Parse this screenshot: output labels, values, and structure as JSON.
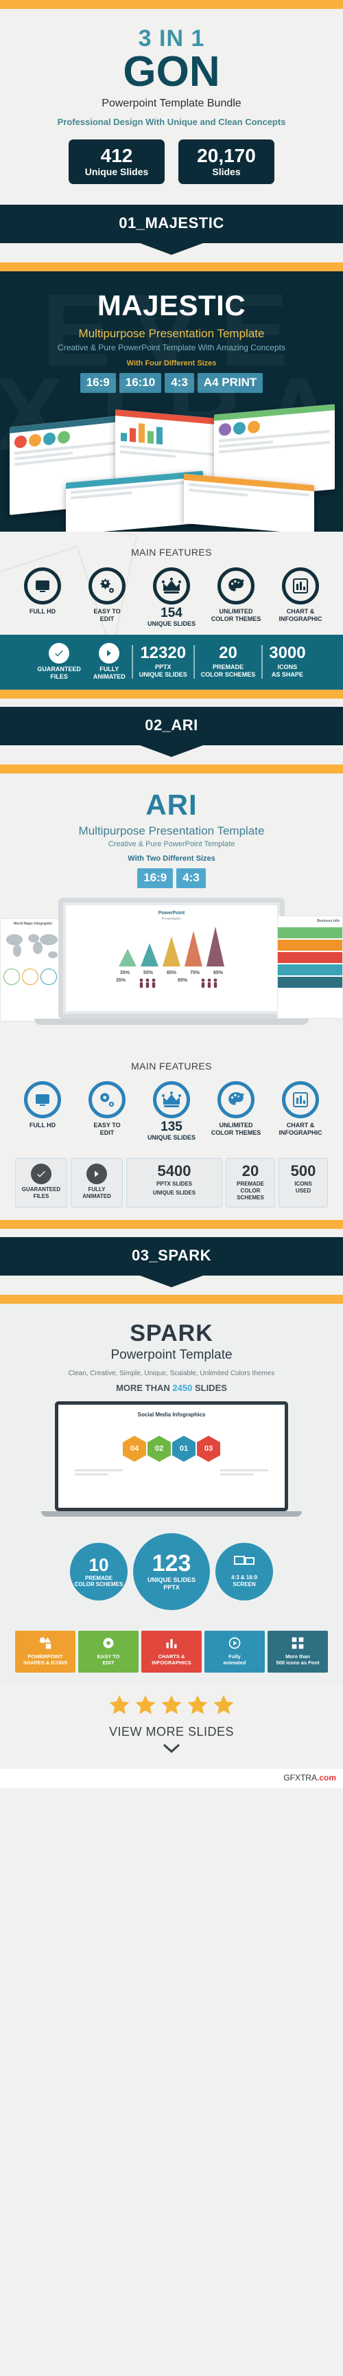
{
  "colors": {
    "amber": "#fbb03b",
    "dark_navy": "#0c2b38",
    "teal": "#12697c",
    "accent_blue": "#2e92b5",
    "light_bg": "#f1f1f0"
  },
  "hero": {
    "three_in_one": "3 IN 1",
    "brand": "GON",
    "subtitle": "Powerpoint Template Bundle",
    "tagline": "Professional Design With Unique and Clean Concepts",
    "stats": [
      {
        "number": "412",
        "label": "Unique Slides"
      },
      {
        "number": "20,170",
        "label": "Slides"
      }
    ]
  },
  "sections": [
    {
      "banner": "01_MAJESTIC",
      "title": "MAJESTIC",
      "subtitle": "Multipurpose Presentation Template",
      "description": "Creative & Pure PowerPoint Template With Amazing Concepts",
      "sizes_label": "With Four Different Sizes",
      "sizes": [
        "16:9",
        "16:10",
        "4:3",
        "A4 PRINT"
      ],
      "features_heading": "MAIN FEATURES",
      "features": [
        {
          "icon": "monitor-icon",
          "label": "FULL HD"
        },
        {
          "icon": "gear-icon",
          "label": "EASY TO\nEDIT"
        },
        {
          "icon": "crown-icon",
          "number": "154",
          "label": "UNIQUE SLIDES"
        },
        {
          "icon": "palette-icon",
          "label": "UNLIMITED\nCOLOR THEMES"
        },
        {
          "icon": "chart-icon",
          "label": "CHART &\nINFOGRAPHIC"
        }
      ],
      "strip": [
        {
          "icon": "check-icon",
          "label": "GUARANTEED\nFILES"
        },
        {
          "icon": "play-icon",
          "label": "FULLY\nANIMATED"
        },
        {
          "number": "12320",
          "label": "PPTX\nUNIQUE SLIDES"
        },
        {
          "number": "20",
          "label": "PREMADE\nCOLOR SCHEMES"
        },
        {
          "number": "3000",
          "label": "ICONS\nAS SHAPE"
        }
      ]
    },
    {
      "banner": "02_ARI",
      "title": "ARI",
      "subtitle": "Multipurpose Presentation Template",
      "description": "Creative & Pure PowerPoint Template",
      "sizes_label": "With Two Different Sizes",
      "sizes": [
        "16:9",
        "4:3"
      ],
      "features_heading": "MAIN FEATURES",
      "features": [
        {
          "icon": "monitor-icon",
          "label": "FULL HD"
        },
        {
          "icon": "gear-icon",
          "label": "EASY TO\nEDIT"
        },
        {
          "icon": "crown-icon",
          "number": "135",
          "label": "UNIQUE SLIDES"
        },
        {
          "icon": "palette-icon",
          "label": "UNLIMITED\nCOLOR THEMES"
        },
        {
          "icon": "chart-icon",
          "label": "CHART &\nINFOGRAPHIC"
        }
      ],
      "cards": [
        {
          "icon": "badge-check-icon",
          "label": "GUARANTEED\nFILES"
        },
        {
          "icon": "play-icon",
          "label": "FULLY\nANIMATED"
        },
        {
          "number": "5400",
          "label": "UNIQUE SLIDES",
          "sup": "PPTX SLIDES"
        },
        {
          "number": "20",
          "label": "PREMADE\nCOLOR SCHEMES"
        },
        {
          "number": "500",
          "label": "ICONS\nUSED"
        }
      ],
      "slide_preview": {
        "title": "PowerPoint",
        "subtitle": "Presentation",
        "percents": [
          "35%",
          "65%"
        ],
        "bar_labels": [
          "35%",
          "55%",
          "65%",
          "75%",
          "85%"
        ],
        "left_label": "World Maps Infographic",
        "right_label": "Business Info"
      }
    },
    {
      "banner": "03_SPARK",
      "title": "SPARK",
      "subtitle": "Powerpoint Template",
      "description": "Clean, Creative, Simple, Unique, Scalable, Unlimited Colors themes",
      "more_than_prefix": "MORE THAN",
      "more_than_number": "2450",
      "more_than_suffix": "SLIDES",
      "slide_preview": {
        "title": "Social Media Infographics",
        "hexes": [
          "04",
          "02",
          "01",
          "03"
        ]
      },
      "stats": [
        {
          "number": "10",
          "label": "PREMADE\nCOLOR SCHEMES"
        },
        {
          "number": "123",
          "label": "UNIQUE SLIDES\nPPTX"
        },
        {
          "number": "",
          "label": "4:3 & 16:9\nSCREEN"
        }
      ],
      "tiles": [
        {
          "color": "#f0a02e",
          "icon": "shapes-icon",
          "label": "POWERPOINT\nSHAPES & ICONS"
        },
        {
          "color": "#6fb644",
          "icon": "gear-icon",
          "label": "EASY TO\nEDIT"
        },
        {
          "color": "#e1473d",
          "icon": "chart-icon",
          "label": "CHARTS &\nINFOGRAPHICS"
        },
        {
          "color": "#2e92b5",
          "icon": "play-icon",
          "label": "Fully\nanimated"
        },
        {
          "color": "#2f6f82",
          "icon": "grid-icon",
          "label": "More than\n500 icons as Font"
        }
      ]
    }
  ],
  "footer": {
    "stars": 5,
    "view_more": "VIEW MORE SLIDES",
    "chevron": "chevron-down-icon"
  },
  "watermark": {
    "brand": "GFXTRA",
    "suffix": ".com"
  }
}
